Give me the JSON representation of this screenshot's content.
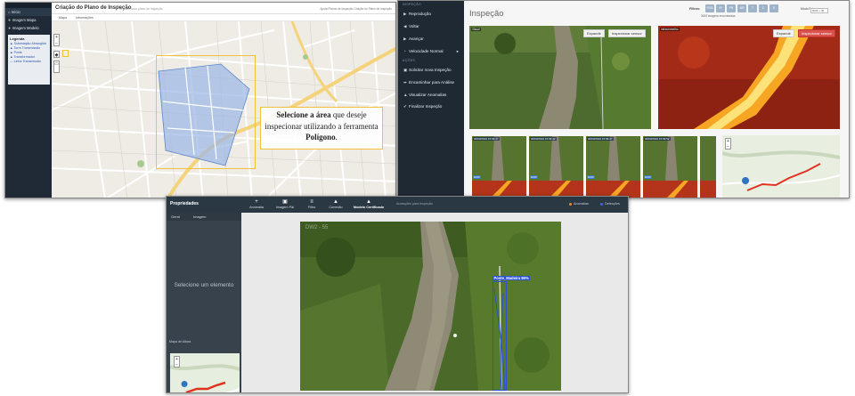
{
  "planning": {
    "title": "Criação do Plano de Inspeção",
    "subtitle": "Criando novo plano de inspeção",
    "top_links": "Ajuda    Planos de Inspeção    Criação do Plano de Inspeção",
    "tabs": [
      "Mapa",
      "Informações"
    ],
    "nav": [
      "Início",
      "Imagem Mapa",
      "Imagem Modelo"
    ],
    "legend_title": "Legenda",
    "legend_items": [
      "Subestação Abrangida",
      "Torre Transmissão",
      "Poste",
      "Transformador",
      "Linha Transmissão"
    ],
    "callout": {
      "part1": "Selecione a área",
      "part2": " que deseje inspecionar utilizando a ferramenta ",
      "part3": "Polígono",
      "part4": "."
    },
    "zoom_in": "+",
    "zoom_out": "−"
  },
  "inspection": {
    "sidebar_section1": "INSPEÇÃO",
    "sidebar_items": [
      "Reprodução",
      "Voltar",
      "Avançar",
      "Velocidade Normal"
    ],
    "sidebar_section2": "AÇÕES",
    "sidebar_actions": [
      "Solicitar nova Inspeção",
      "Encaminhar para Análise",
      "Visualizar Anomalias",
      "Finalizar Inspeção"
    ],
    "title": "Inspeção",
    "filter_label": "Filtros:",
    "filters": [
      "RGB",
      "IR",
      "PN",
      "AIR",
      "T",
      "C",
      "S"
    ],
    "image_count": "3000 imagens encontradas",
    "view_label": "Modo Foto",
    "view_select": "RGB + IR",
    "rgb_tag": "Visual",
    "ir_tag": "Infravermelho",
    "expand": "Expandir",
    "inspect_sensor": "Inspecionar sensor",
    "thumb_times": [
      "30/03/2019 15:09:37",
      "30/03/2019 15:09:42",
      "30/03/2019 15:09:47",
      "30/03/2019 15:09:52"
    ],
    "thumb_badge": "RGB"
  },
  "ai": {
    "properties": "Propriedades",
    "tools": [
      "Anomalia",
      "Imagem Pai",
      "Filtro",
      "Conexão",
      "Modelo Certificado"
    ],
    "hint": "Anotações para Inspeção",
    "legend_anomalies": "Anomalias",
    "legend_detections": "Detecções",
    "left_tabs": [
      "Geral",
      "Imagem"
    ],
    "empty_message": "Selecione um elemento",
    "map_label": "Mapa de Altura",
    "detection_label": "Poste_Madeira 99%",
    "stamp": "DW2 - 55",
    "colors": {
      "detection": "#2a52d1",
      "anomaly": "#f0892b",
      "accent": "#f0c23a",
      "ir_hot": "#f6a623"
    }
  }
}
